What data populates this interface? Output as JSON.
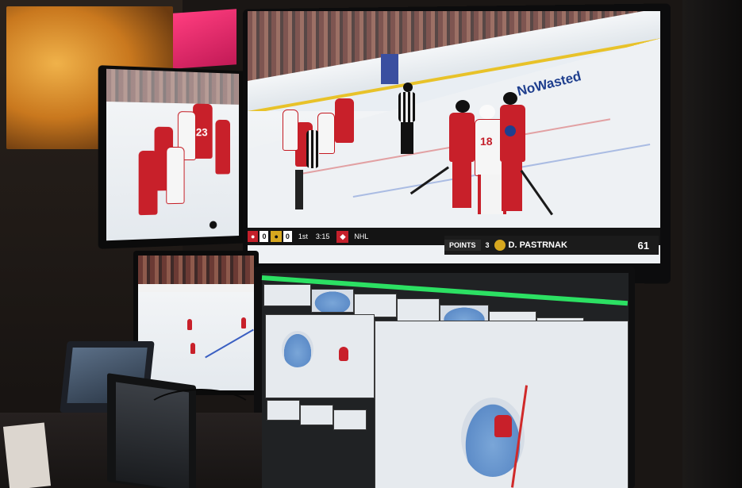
{
  "main_broadcast": {
    "rink_ad": "NoWasted",
    "player_number": "18",
    "scorebug": {
      "team1_score": "0",
      "team2_score": "0",
      "period": "1st",
      "clock": "3:15",
      "league": "NHL",
      "stat_label": "POINTS",
      "stat_rank": "3",
      "player_name": "D. PASTRNAK",
      "stat_value": "61"
    }
  },
  "left_monitor": {
    "player_number": "23"
  },
  "colors": {
    "multiview_tally": "#2ce063",
    "home_red": "#c8202a",
    "away_gold": "#d6a71f"
  }
}
